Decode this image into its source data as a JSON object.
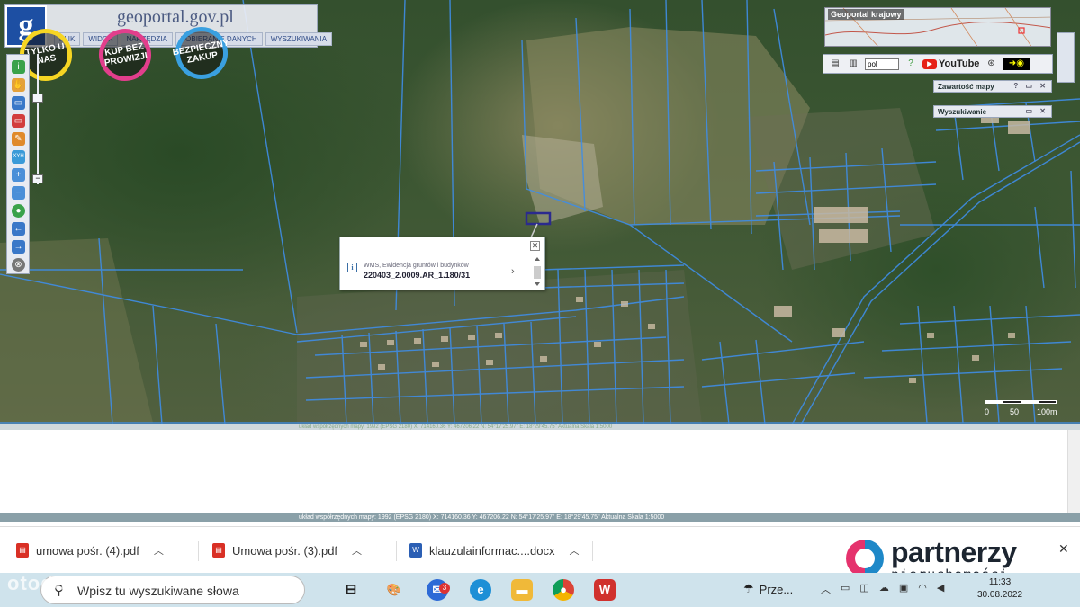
{
  "geoportal": {
    "site_title": "geoportal.gov.pl",
    "logo_letter": "g",
    "menu": [
      "PLIK",
      "WIDOK",
      "NARZĘDZIA",
      "POBIERANIE DANYCH",
      "WYSZUKIWANIA"
    ],
    "promo_badges": [
      {
        "text": "TYLKO U NAS",
        "color": "#f6d523"
      },
      {
        "text": "KUP BEZ PROWIZJI",
        "color": "#e23e8c"
      },
      {
        "text": "BEZPIECZNY ZAKUP",
        "color": "#3aa0e0"
      }
    ],
    "minimap_title": "Geoportal krajowy",
    "language": "pol",
    "youtube_label": "YouTube",
    "panels": [
      {
        "title": "Zawartość mapy",
        "controls": "? ▭ ✕"
      },
      {
        "title": "Wyszukiwanie",
        "controls": "▭ ✕"
      }
    ],
    "popup": {
      "source": "WMS, Ewidencja gruntów i budynków",
      "parcel_id": "220403_2.0009.AR_1.180/31"
    },
    "scale_labels": [
      "0",
      "50",
      "100m"
    ],
    "status_line": "układ współrzędnych mapy: 1992 (EPSG 2180)   X: 714160.36  Y: 467206.22   N: 54°17'25.97\"  E: 18°29'45.75\"   Aktualna Skala 1:5000"
  },
  "downloads": [
    {
      "name": "umowa pośr. (4).pdf",
      "type": "pdf",
      "color": "#d93025"
    },
    {
      "name": "Umowa pośr. (3).pdf",
      "type": "pdf",
      "color": "#d93025"
    },
    {
      "name": "klauzulainformac....docx",
      "type": "docx",
      "color": "#2b5fb4"
    }
  ],
  "brand": {
    "name": "partnerzy",
    "subtitle": "nieruchomości"
  },
  "taskbar": {
    "search_placeholder": "Wpisz tu wyszukiwane słowa",
    "weather_label": "Prze...",
    "time": "11:33",
    "date": "30.08.2022",
    "notification_badge": "3"
  },
  "watermark": "otodom"
}
